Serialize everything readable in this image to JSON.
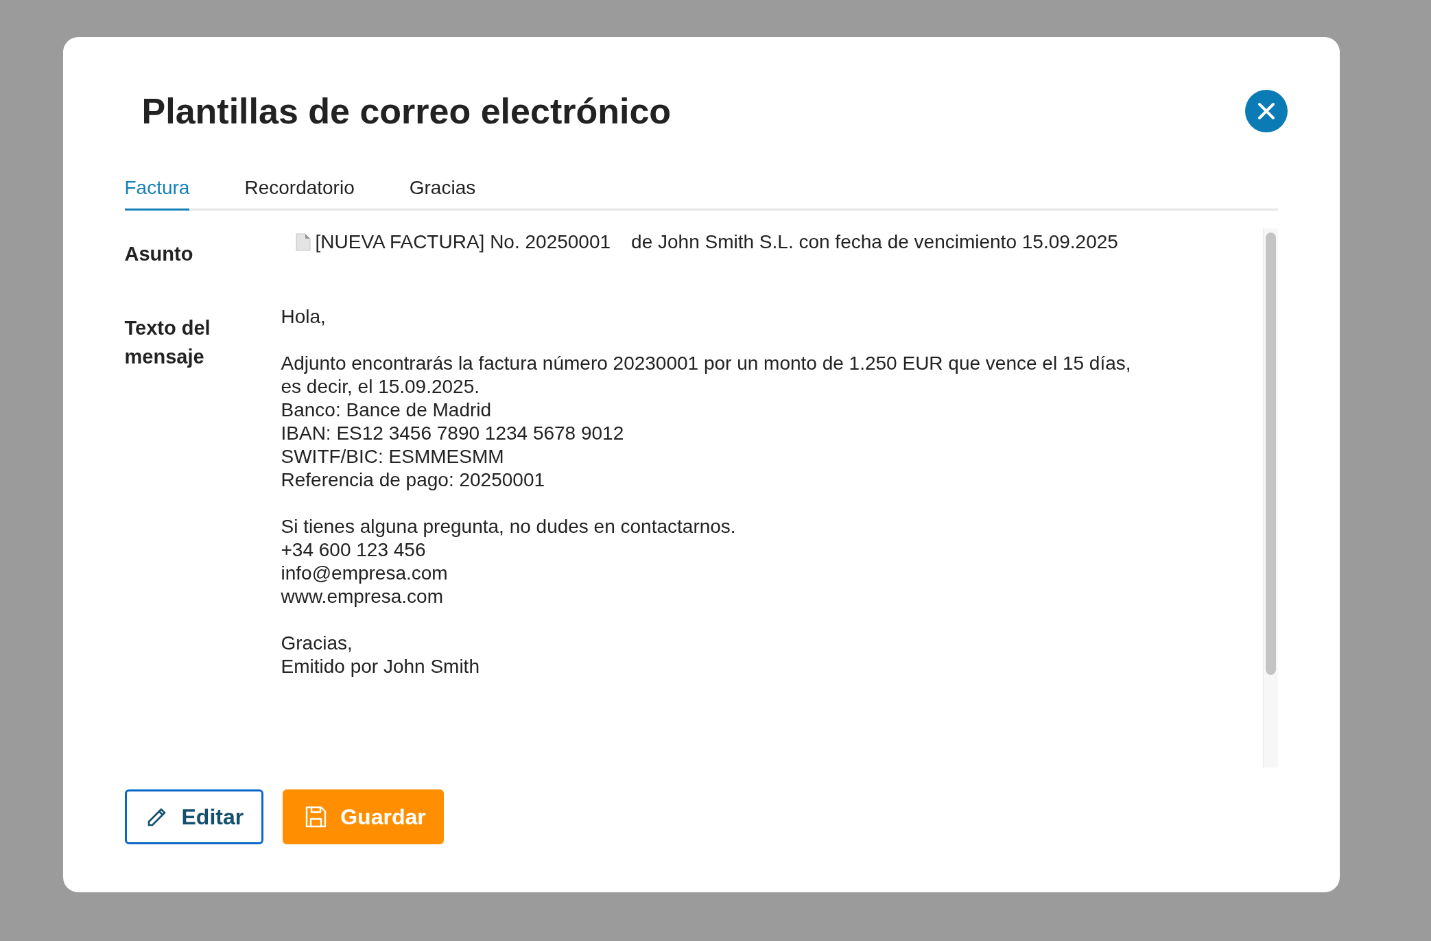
{
  "dialog": {
    "title": "Plantillas de correo electrónico"
  },
  "tabs": [
    {
      "label": "Factura",
      "selected": true
    },
    {
      "label": "Recordatorio",
      "selected": false
    },
    {
      "label": "Gracias",
      "selected": false
    }
  ],
  "subject": {
    "label": "Asunto",
    "prefix": "[NUEVA FACTURA] No. 20250001",
    "rest": "de John Smith S.L. con fecha de vencimiento 15.09.2025"
  },
  "message": {
    "label": "Texto del mensaje",
    "paragraphs": [
      [
        "Hola,"
      ],
      [
        "Adjunto encontrarás la factura número 20230001 por un monto de 1.250 EUR que vence el 15 días,",
        "es decir, el 15.09.2025.",
        "Banco: Bance de Madrid",
        "IBAN: ES12 3456 7890 1234 5678 9012",
        "SWITF/BIC: ESMMESMM",
        "Referencia de pago: 20250001"
      ],
      [
        "Si tienes alguna pregunta, no dudes en contactarnos.",
        "+34 600 123 456",
        "info@empresa.com",
        "www.empresa.com"
      ],
      [
        "Gracias,",
        "Emitido por John Smith"
      ]
    ]
  },
  "buttons": [
    {
      "label": "Editar",
      "kind": "edit"
    },
    {
      "label": "Guardar",
      "kind": "save"
    }
  ]
}
